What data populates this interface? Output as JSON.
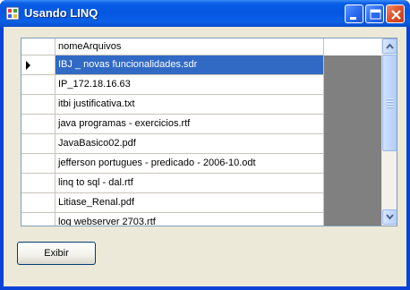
{
  "window": {
    "title": "Usando LINQ"
  },
  "grid": {
    "column_header": "nomeArquivos",
    "selected_index": 0,
    "rows": [
      "IBJ _ novas funcionalidades.sdr",
      "IP_172.18.16.63",
      "itbi justificativa.txt",
      "java programas - exercicios.rtf",
      "JavaBasico02.pdf",
      "jefferson portugues - predicado - 2006-10.odt",
      "linq to sql - dal.rtf",
      "Litiase_Renal.pdf",
      "log webserver 2703.rtf"
    ]
  },
  "actions": {
    "exibir_label": "Exibir"
  },
  "colors": {
    "selection": "#316ac5",
    "titlebar": "#0a5fe6",
    "client": "#ece9d8"
  },
  "icons": {
    "minimize": "minimize-icon",
    "maximize": "maximize-icon",
    "close": "close-icon"
  }
}
